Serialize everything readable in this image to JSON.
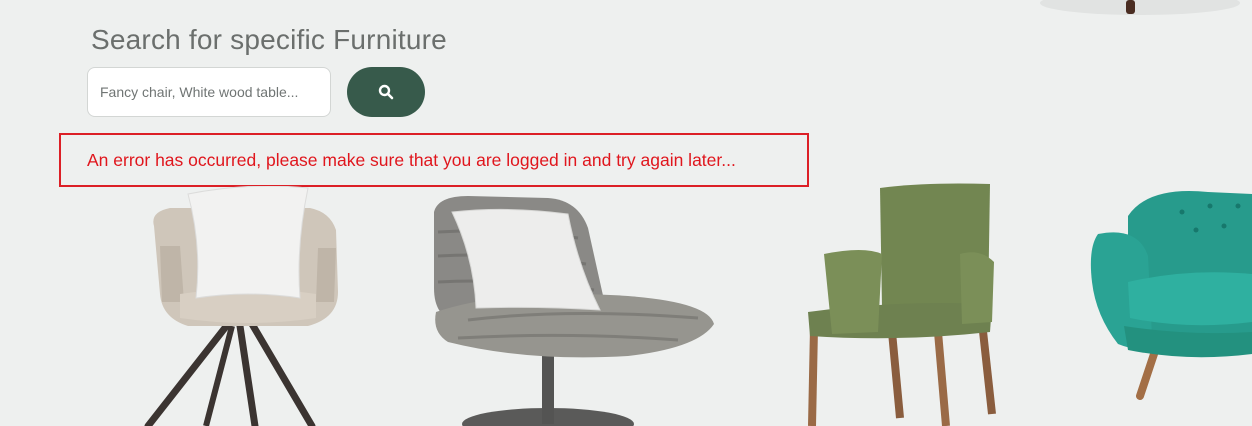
{
  "search": {
    "title": "Search for specific Furniture",
    "placeholder": "Fancy chair, White wood table...",
    "value": "",
    "button_icon": "search-icon"
  },
  "error": {
    "message": "An error has occurred, please make sure that you are logged in and try again later..."
  },
  "colors": {
    "page_background": "#eef0ef",
    "accent": "#375a4b",
    "error": "#e0161d",
    "title": "#6b6f6d"
  },
  "products": [
    {
      "image": "beige-swivel-armchair-with-white-pillow"
    },
    {
      "image": "gray-quilted-lounge-chair-with-white-pillow"
    },
    {
      "image": "olive-green-dining-armchair"
    },
    {
      "image": "teal-tufted-armchair"
    },
    {
      "image": "dark-wood-furniture-leg"
    }
  ]
}
